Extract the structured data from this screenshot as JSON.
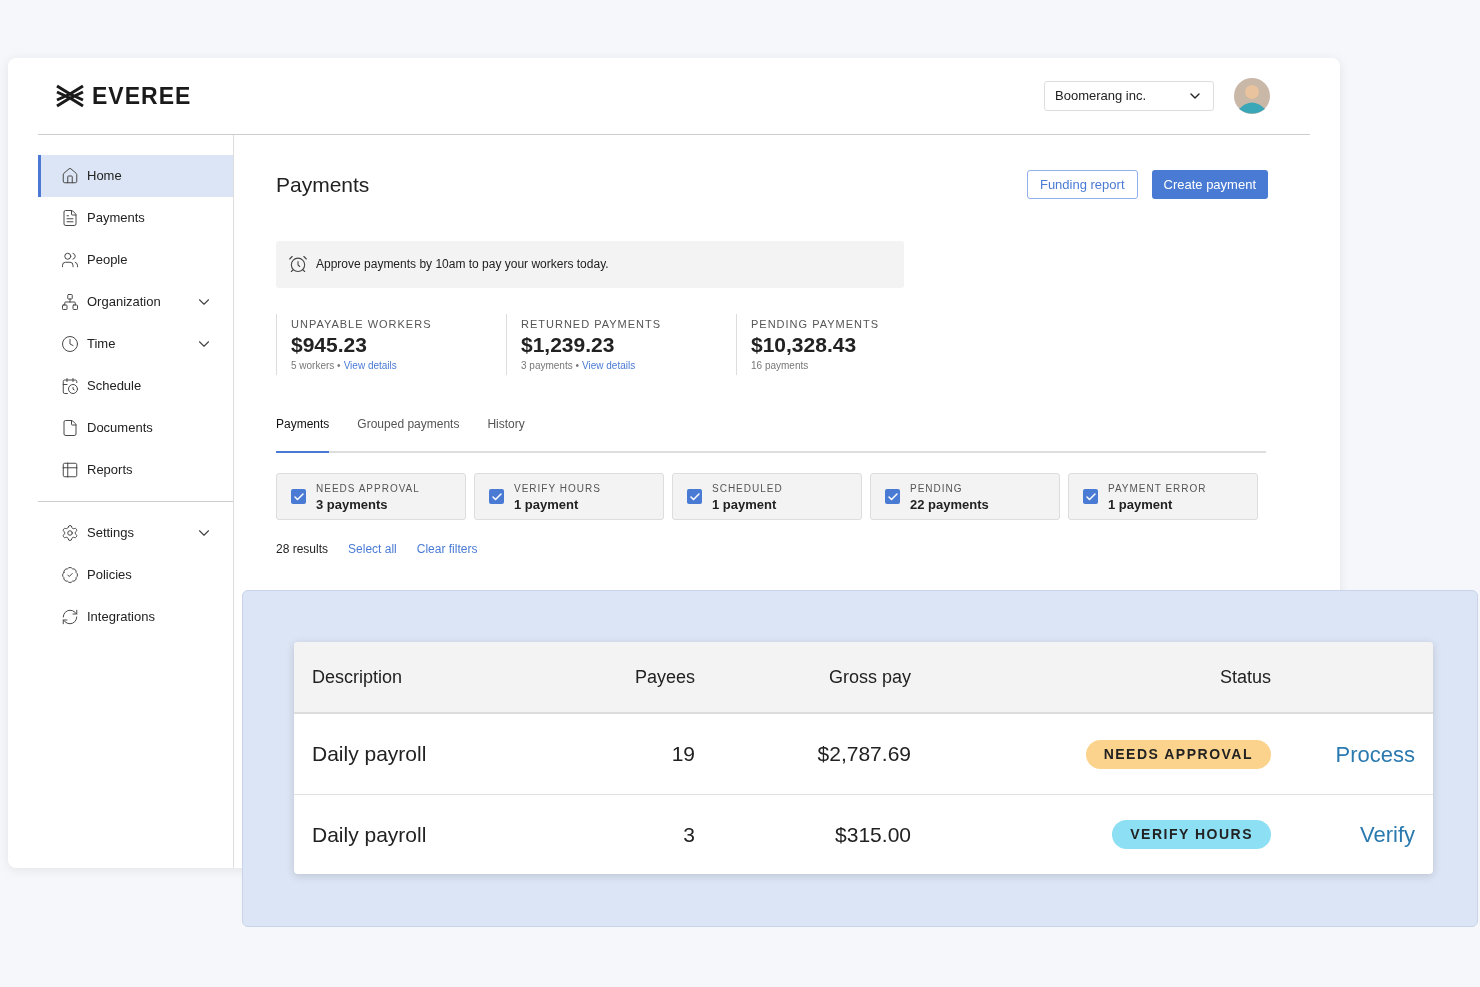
{
  "brand": {
    "name": "EVEREE"
  },
  "header": {
    "company": "Boomerang inc."
  },
  "sidebar": {
    "items": [
      {
        "label": "Home",
        "selected": true,
        "expandable": false
      },
      {
        "label": "Payments",
        "selected": false,
        "expandable": false
      },
      {
        "label": "People",
        "selected": false,
        "expandable": false
      },
      {
        "label": "Organization",
        "selected": false,
        "expandable": true
      },
      {
        "label": "Time",
        "selected": false,
        "expandable": true
      },
      {
        "label": "Schedule",
        "selected": false,
        "expandable": false
      },
      {
        "label": "Documents",
        "selected": false,
        "expandable": false
      },
      {
        "label": "Reports",
        "selected": false,
        "expandable": false
      }
    ],
    "bottom_items": [
      {
        "label": "Settings",
        "selected": false,
        "expandable": true
      },
      {
        "label": "Policies",
        "selected": false,
        "expandable": false
      },
      {
        "label": "Integrations",
        "selected": false,
        "expandable": false
      }
    ]
  },
  "page": {
    "title": "Payments",
    "buttons": [
      {
        "label": "Funding report",
        "kind": "outline"
      },
      {
        "label": "Create payment",
        "kind": "primary"
      }
    ]
  },
  "notice": {
    "text": "Approve payments by 10am to pay your workers today."
  },
  "stats": [
    {
      "label": "UNPAYABLE WORKERS",
      "value": "$945.23",
      "note": "5 workers •",
      "link": "View details"
    },
    {
      "label": "RETURNED PAYMENTS",
      "value": "$1,239.23",
      "note": "3 payments •",
      "link": "View details"
    },
    {
      "label": "PENDING PAYMENTS",
      "value": "$10,328.43",
      "note": "16 payments"
    }
  ],
  "tabs": [
    {
      "label": "Payments",
      "selected": true
    },
    {
      "label": "Grouped payments",
      "selected": false
    },
    {
      "label": "History",
      "selected": false
    }
  ],
  "filters": [
    {
      "label": "NEEDS APPROVAL",
      "count": "3 payments",
      "checked": true
    },
    {
      "label": "VERIFY HOURS",
      "count": "1 payment",
      "checked": true
    },
    {
      "label": "SCHEDULED",
      "count": "1 payment",
      "checked": true
    },
    {
      "label": "PENDING",
      "count": "22 payments",
      "checked": true
    },
    {
      "label": "PAYMENT ERROR",
      "count": "1 payment",
      "checked": true
    }
  ],
  "results": {
    "count": "28 results",
    "links": [
      "Select all",
      "Clear filters"
    ]
  },
  "table": {
    "columns": [
      "Description",
      "Payees",
      "Gross pay",
      "Status"
    ],
    "rows": [
      {
        "description": "Daily payroll",
        "payees": "19",
        "gross_pay": "$2,787.69",
        "status": "NEEDS APPROVAL",
        "color": "#fbd38d",
        "action": "Process"
      },
      {
        "description": "Daily payroll",
        "payees": "3",
        "gross_pay": "$315.00",
        "status": "VERIFY HOURS",
        "color": "#8ddff3",
        "action": "Verify"
      }
    ]
  }
}
